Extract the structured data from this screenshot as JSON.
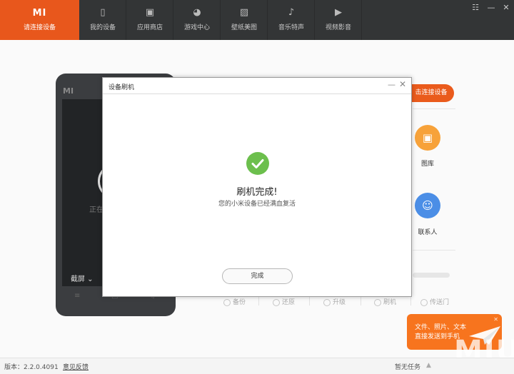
{
  "brand": {
    "logo": "MI",
    "label": "请连接设备",
    "color": "#e8571c"
  },
  "nav": [
    {
      "label": "我的设备",
      "icon": "phone-icon"
    },
    {
      "label": "应用商店",
      "icon": "bag-icon"
    },
    {
      "label": "游戏中心",
      "icon": "gamepad-icon"
    },
    {
      "label": "壁纸美图",
      "icon": "image-icon"
    },
    {
      "label": "音乐特声",
      "icon": "music-note-icon"
    },
    {
      "label": "视频影音",
      "icon": "video-icon"
    }
  ],
  "window_controls": {
    "menu": "☷",
    "minimize": "—",
    "close": "✕"
  },
  "phone": {
    "logo": "MI",
    "status_text": "正在",
    "screenshot_label": "截屏 ⌄",
    "nav_buttons": [
      "≡",
      "□",
      "◁"
    ]
  },
  "right_panel": {
    "connect_button": "击连接设备",
    "gallery_label": "图库",
    "contacts_label": "联系人",
    "accent_color": "#ea5b1c",
    "gallery_color": "#f7a23a",
    "contacts_color": "#4b8ee6"
  },
  "bottom_tools": [
    {
      "label": "备份",
      "icon": "backup-icon"
    },
    {
      "label": "还原",
      "icon": "restore-icon"
    },
    {
      "label": "升级",
      "icon": "upgrade-icon"
    },
    {
      "label": "刷机",
      "icon": "flash-icon"
    },
    {
      "label": "传送门",
      "icon": "send-icon"
    }
  ],
  "tooltip": {
    "line1": "文件、照片、文本",
    "line2": "直接发送到手机",
    "close": "✕"
  },
  "watermark": "MIUI",
  "status_bar": {
    "version": "版本：2.2.0.4091",
    "feedback": "意见反馈",
    "tasks": "暂无任务",
    "task_icon": "▲"
  },
  "modal": {
    "title": "设备刷机",
    "minimize": "—",
    "close": "✕",
    "heading": "刷机完成!",
    "message": "您的小米设备已经满血复活",
    "done_button": "完成",
    "check_color": "#6cbf4d"
  }
}
